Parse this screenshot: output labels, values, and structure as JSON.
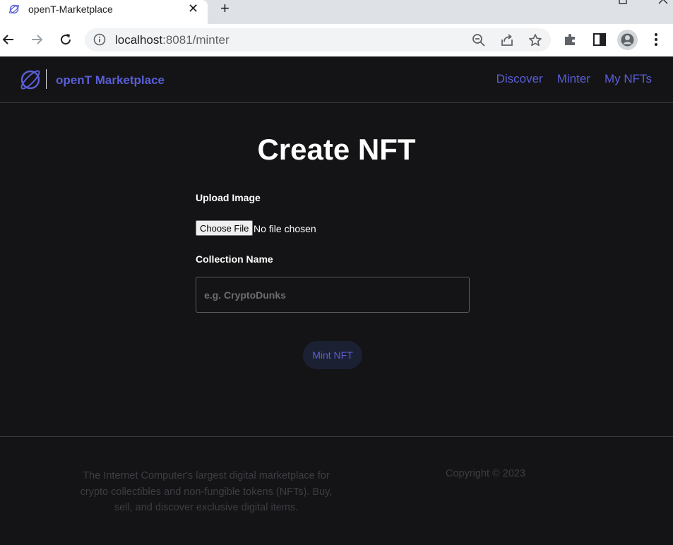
{
  "browser": {
    "tab_title": "openT-Marketplace",
    "tab_close": "✕",
    "new_tab": "+",
    "url_host": "localhost",
    "url_path": ":8081/minter"
  },
  "header": {
    "brand": "openT Marketplace",
    "nav": [
      "Discover",
      "Minter",
      "My NFTs"
    ]
  },
  "main": {
    "title": "Create NFT",
    "upload_label": "Upload Image",
    "file_button": "Choose File",
    "file_status": "No file chosen",
    "collection_label": "Collection Name",
    "collection_placeholder": "e.g. CryptoDunks",
    "collection_value": "",
    "mint_button": "Mint NFT"
  },
  "footer": {
    "description": "The Internet Computer's largest digital marketplace for crypto collectibles and non-fungible tokens (NFTs). Buy, sell, and discover exclusive digital items.",
    "copyright": "Copyright © 2023"
  },
  "colors": {
    "accent": "#5a5ed6",
    "background": "#141416",
    "mint_button_bg": "#1c2033",
    "footer_text": "#3d3d43"
  }
}
